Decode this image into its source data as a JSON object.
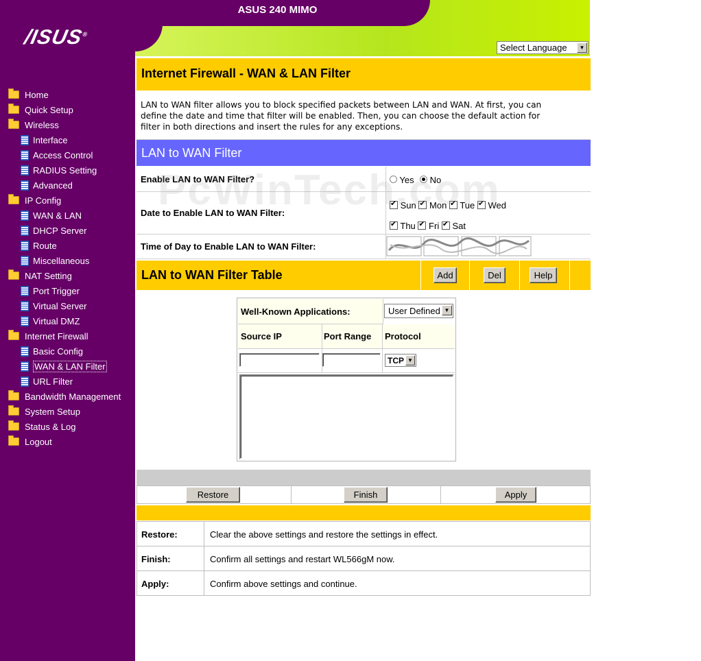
{
  "header": {
    "app_title": "ASUS 240 MIMO",
    "logo_text": "/ISUS",
    "language_select": "Select Language"
  },
  "sidebar": {
    "items": [
      {
        "label": "Home",
        "icon": "folder-icon"
      },
      {
        "label": "Quick Setup",
        "icon": "folder-icon"
      },
      {
        "label": "Wireless",
        "icon": "open-folder-icon"
      },
      {
        "label": "Interface",
        "icon": "page-icon"
      },
      {
        "label": "Access Control",
        "icon": "page-icon"
      },
      {
        "label": "RADIUS Setting",
        "icon": "page-icon"
      },
      {
        "label": "Advanced",
        "icon": "page-icon"
      },
      {
        "label": "IP Config",
        "icon": "open-folder-icon"
      },
      {
        "label": "WAN & LAN",
        "icon": "page-icon"
      },
      {
        "label": "DHCP Server",
        "icon": "page-icon"
      },
      {
        "label": "Route",
        "icon": "page-icon"
      },
      {
        "label": "Miscellaneous",
        "icon": "page-icon"
      },
      {
        "label": "NAT Setting",
        "icon": "open-folder-icon"
      },
      {
        "label": "Port Trigger",
        "icon": "page-icon"
      },
      {
        "label": "Virtual Server",
        "icon": "page-icon"
      },
      {
        "label": "Virtual DMZ",
        "icon": "page-icon"
      },
      {
        "label": "Internet Firewall",
        "icon": "open-folder-icon"
      },
      {
        "label": "Basic Config",
        "icon": "page-icon"
      },
      {
        "label": "WAN & LAN Filter",
        "icon": "page-icon"
      },
      {
        "label": "URL Filter",
        "icon": "page-icon"
      },
      {
        "label": "Bandwidth Management",
        "icon": "folder-icon"
      },
      {
        "label": "System Setup",
        "icon": "folder-icon"
      },
      {
        "label": "Status & Log",
        "icon": "folder-icon"
      },
      {
        "label": "Logout",
        "icon": "folder-icon"
      }
    ]
  },
  "main": {
    "page_title": "Internet Firewall - WAN & LAN Filter",
    "intro_line1": "LAN to WAN filter allows you to block specified packets between LAN and WAN. At first, you can",
    "intro_line2": "define the date and time that filter will be enabled. Then, you can choose the default action for",
    "intro_line3": "filter in both directions and insert the rules for any exceptions.",
    "section1_title": "LAN to WAN Filter",
    "enable_label": "Enable LAN to WAN Filter?",
    "enable_yes": "Yes",
    "enable_no": "No",
    "date_label": "Date to Enable LAN to WAN Filter:",
    "days": [
      "Sun",
      "Mon",
      "Tue",
      "Wed",
      "Thu",
      "Fri",
      "Sat"
    ],
    "time_label": "Time of Day to Enable LAN to WAN Filter:",
    "watermark": "PcWinTech.com",
    "section2_title": "LAN to WAN Filter Table",
    "add_button": "Add",
    "del_button": "Del",
    "help_button": "Help",
    "table": {
      "well_known_label": "Well-Known Applications:",
      "well_known_value": "User Defined",
      "col_source_ip": "Source IP",
      "col_port_range": "Port Range",
      "col_protocol": "Protocol",
      "protocol_value": "TCP"
    },
    "restore_button": "Restore",
    "finish_button": "Finish",
    "apply_button": "Apply"
  },
  "footer": {
    "rows": [
      {
        "label": "Restore:",
        "text": "Clear the above settings and restore the settings in effect."
      },
      {
        "label": "Finish:",
        "text": "Confirm all settings and restart WL566gM now."
      },
      {
        "label": "Apply:",
        "text": "Confirm above settings and continue."
      }
    ]
  }
}
